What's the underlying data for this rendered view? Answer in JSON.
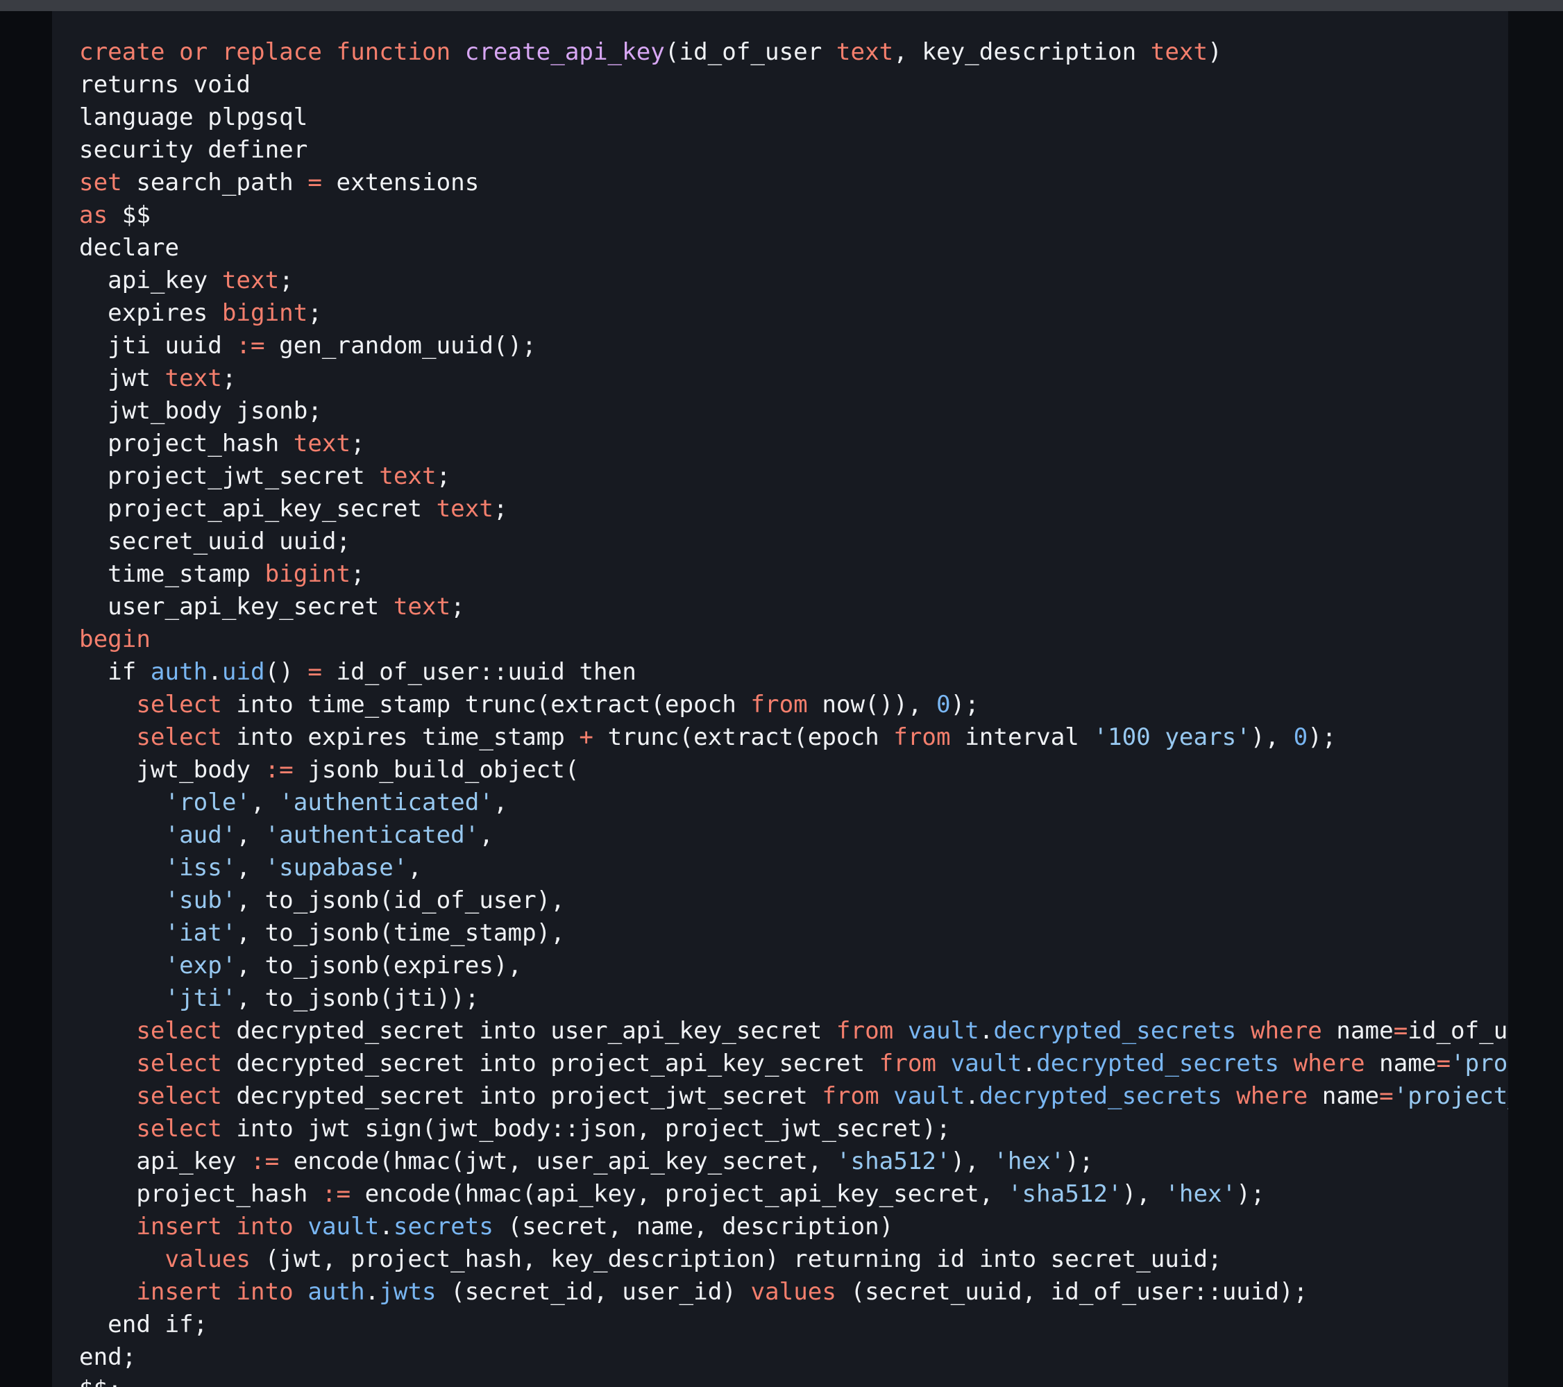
{
  "colors": {
    "background": "#171a21",
    "keyword": "#f47f6d",
    "function_name": "#d8a7f4",
    "string": "#97c8f0",
    "number": "#79b6f2",
    "schema": "#79b6f2",
    "plain": "#f0f2f5"
  },
  "code": {
    "language": "plpgsql",
    "lines": [
      [
        [
          "kw",
          "create or replace function "
        ],
        [
          "fn",
          "create_api_key"
        ],
        [
          "pl",
          "(id_of_user "
        ],
        [
          "kw",
          "text"
        ],
        [
          "pl",
          ", key_description "
        ],
        [
          "kw",
          "text"
        ],
        [
          "pl",
          ")"
        ]
      ],
      [
        [
          "pl",
          "returns void"
        ]
      ],
      [
        [
          "pl",
          "language plpgsql"
        ]
      ],
      [
        [
          "pl",
          "security definer"
        ]
      ],
      [
        [
          "kw",
          "set"
        ],
        [
          "pl",
          " search_path "
        ],
        [
          "op",
          "="
        ],
        [
          "pl",
          " extensions"
        ]
      ],
      [
        [
          "kw",
          "as"
        ],
        [
          "pl",
          " $$"
        ]
      ],
      [
        [
          "pl",
          "declare"
        ]
      ],
      [
        [
          "pl",
          "  api_key "
        ],
        [
          "kw",
          "text"
        ],
        [
          "pl",
          ";"
        ]
      ],
      [
        [
          "pl",
          "  expires "
        ],
        [
          "kw",
          "bigint"
        ],
        [
          "pl",
          ";"
        ]
      ],
      [
        [
          "pl",
          "  jti uuid "
        ],
        [
          "op",
          ":="
        ],
        [
          "pl",
          " gen_random_uuid();"
        ]
      ],
      [
        [
          "pl",
          "  jwt "
        ],
        [
          "kw",
          "text"
        ],
        [
          "pl",
          ";"
        ]
      ],
      [
        [
          "pl",
          "  jwt_body jsonb;"
        ]
      ],
      [
        [
          "pl",
          "  project_hash "
        ],
        [
          "kw",
          "text"
        ],
        [
          "pl",
          ";"
        ]
      ],
      [
        [
          "pl",
          "  project_jwt_secret "
        ],
        [
          "kw",
          "text"
        ],
        [
          "pl",
          ";"
        ]
      ],
      [
        [
          "pl",
          "  project_api_key_secret "
        ],
        [
          "kw",
          "text"
        ],
        [
          "pl",
          ";"
        ]
      ],
      [
        [
          "pl",
          "  secret_uuid uuid;"
        ]
      ],
      [
        [
          "pl",
          "  time_stamp "
        ],
        [
          "kw",
          "bigint"
        ],
        [
          "pl",
          ";"
        ]
      ],
      [
        [
          "pl",
          "  user_api_key_secret "
        ],
        [
          "kw",
          "text"
        ],
        [
          "pl",
          ";"
        ]
      ],
      [
        [
          "kw",
          "begin"
        ]
      ],
      [
        [
          "pl",
          "  if "
        ],
        [
          "ns",
          "auth"
        ],
        [
          "pl",
          "."
        ],
        [
          "ns",
          "uid"
        ],
        [
          "pl",
          "() "
        ],
        [
          "op",
          "="
        ],
        [
          "pl",
          " id_of_user::uuid then"
        ]
      ],
      [
        [
          "pl",
          "    "
        ],
        [
          "kw",
          "select"
        ],
        [
          "pl",
          " into time_stamp trunc(extract(epoch "
        ],
        [
          "kw",
          "from"
        ],
        [
          "pl",
          " now()), "
        ],
        [
          "num",
          "0"
        ],
        [
          "pl",
          ");"
        ]
      ],
      [
        [
          "pl",
          "    "
        ],
        [
          "kw",
          "select"
        ],
        [
          "pl",
          " into expires time_stamp "
        ],
        [
          "op",
          "+"
        ],
        [
          "pl",
          " trunc(extract(epoch "
        ],
        [
          "kw",
          "from"
        ],
        [
          "pl",
          " interval "
        ],
        [
          "str",
          "'100 years'"
        ],
        [
          "pl",
          "), "
        ],
        [
          "num",
          "0"
        ],
        [
          "pl",
          ");"
        ]
      ],
      [
        [
          "pl",
          "    jwt_body "
        ],
        [
          "op",
          ":="
        ],
        [
          "pl",
          " jsonb_build_object("
        ]
      ],
      [
        [
          "pl",
          "      "
        ],
        [
          "str",
          "'role'"
        ],
        [
          "pl",
          ", "
        ],
        [
          "str",
          "'authenticated'"
        ],
        [
          "pl",
          ","
        ]
      ],
      [
        [
          "pl",
          "      "
        ],
        [
          "str",
          "'aud'"
        ],
        [
          "pl",
          ", "
        ],
        [
          "str",
          "'authenticated'"
        ],
        [
          "pl",
          ","
        ]
      ],
      [
        [
          "pl",
          "      "
        ],
        [
          "str",
          "'iss'"
        ],
        [
          "pl",
          ", "
        ],
        [
          "str",
          "'supabase'"
        ],
        [
          "pl",
          ","
        ]
      ],
      [
        [
          "pl",
          "      "
        ],
        [
          "str",
          "'sub'"
        ],
        [
          "pl",
          ", to_jsonb(id_of_user),"
        ]
      ],
      [
        [
          "pl",
          "      "
        ],
        [
          "str",
          "'iat'"
        ],
        [
          "pl",
          ", to_jsonb(time_stamp),"
        ]
      ],
      [
        [
          "pl",
          "      "
        ],
        [
          "str",
          "'exp'"
        ],
        [
          "pl",
          ", to_jsonb(expires),"
        ]
      ],
      [
        [
          "pl",
          "      "
        ],
        [
          "str",
          "'jti'"
        ],
        [
          "pl",
          ", to_jsonb(jti));"
        ]
      ],
      [
        [
          "pl",
          "    "
        ],
        [
          "kw",
          "select"
        ],
        [
          "pl",
          " decrypted_secret into user_api_key_secret "
        ],
        [
          "kw",
          "from"
        ],
        [
          "pl",
          " "
        ],
        [
          "ns",
          "vault"
        ],
        [
          "pl",
          "."
        ],
        [
          "ns",
          "decrypted_secrets"
        ],
        [
          "pl",
          " "
        ],
        [
          "kw",
          "where"
        ],
        [
          "pl",
          " name"
        ],
        [
          "op",
          "="
        ],
        [
          "pl",
          "id_of_user;"
        ]
      ],
      [
        [
          "pl",
          "    "
        ],
        [
          "kw",
          "select"
        ],
        [
          "pl",
          " decrypted_secret into project_api_key_secret "
        ],
        [
          "kw",
          "from"
        ],
        [
          "pl",
          " "
        ],
        [
          "ns",
          "vault"
        ],
        [
          "pl",
          "."
        ],
        [
          "ns",
          "decrypted_secrets"
        ],
        [
          "pl",
          " "
        ],
        [
          "kw",
          "where"
        ],
        [
          "pl",
          " name"
        ],
        [
          "op",
          "="
        ],
        [
          "str",
          "'project_api"
        ]
      ],
      [
        [
          "pl",
          "    "
        ],
        [
          "kw",
          "select"
        ],
        [
          "pl",
          " decrypted_secret into project_jwt_secret "
        ],
        [
          "kw",
          "from"
        ],
        [
          "pl",
          " "
        ],
        [
          "ns",
          "vault"
        ],
        [
          "pl",
          "."
        ],
        [
          "ns",
          "decrypted_secrets"
        ],
        [
          "pl",
          " "
        ],
        [
          "kw",
          "where"
        ],
        [
          "pl",
          " name"
        ],
        [
          "op",
          "="
        ],
        [
          "str",
          "'project_jwt_sec"
        ]
      ],
      [
        [
          "pl",
          "    "
        ],
        [
          "kw",
          "select"
        ],
        [
          "pl",
          " into jwt sign(jwt_body::json, project_jwt_secret);"
        ]
      ],
      [
        [
          "pl",
          "    api_key "
        ],
        [
          "op",
          ":="
        ],
        [
          "pl",
          " encode(hmac(jwt, user_api_key_secret, "
        ],
        [
          "str",
          "'sha512'"
        ],
        [
          "pl",
          "), "
        ],
        [
          "str",
          "'hex'"
        ],
        [
          "pl",
          ");"
        ]
      ],
      [
        [
          "pl",
          "    project_hash "
        ],
        [
          "op",
          ":="
        ],
        [
          "pl",
          " encode(hmac(api_key, project_api_key_secret, "
        ],
        [
          "str",
          "'sha512'"
        ],
        [
          "pl",
          "), "
        ],
        [
          "str",
          "'hex'"
        ],
        [
          "pl",
          ");"
        ]
      ],
      [
        [
          "pl",
          "    "
        ],
        [
          "kw",
          "insert into"
        ],
        [
          "pl",
          " "
        ],
        [
          "ns",
          "vault"
        ],
        [
          "pl",
          "."
        ],
        [
          "ns",
          "secrets"
        ],
        [
          "pl",
          " (secret, name, description)"
        ]
      ],
      [
        [
          "pl",
          "      "
        ],
        [
          "kw",
          "values"
        ],
        [
          "pl",
          " (jwt, project_hash, key_description) returning id into secret_uuid;"
        ]
      ],
      [
        [
          "pl",
          "    "
        ],
        [
          "kw",
          "insert into"
        ],
        [
          "pl",
          " "
        ],
        [
          "ns",
          "auth"
        ],
        [
          "pl",
          "."
        ],
        [
          "ns",
          "jwts"
        ],
        [
          "pl",
          " (secret_id, user_id) "
        ],
        [
          "kw",
          "values"
        ],
        [
          "pl",
          " (secret_uuid, id_of_user::uuid);"
        ]
      ],
      [
        [
          "pl",
          "  end if;"
        ]
      ],
      [
        [
          "pl",
          "end;"
        ]
      ],
      [
        [
          "pl",
          "$$;"
        ]
      ]
    ]
  }
}
